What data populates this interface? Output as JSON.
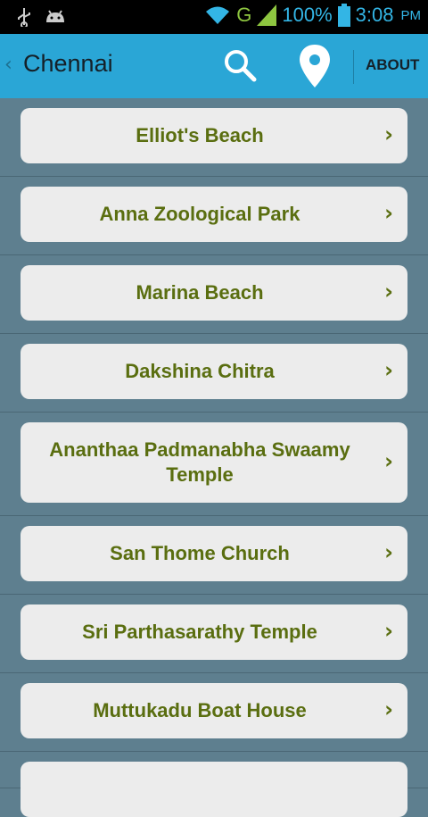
{
  "status_bar": {
    "battery": "100%",
    "network": "G",
    "time": "3:08",
    "ampm": "PM"
  },
  "app_bar": {
    "back_glyph": "‹",
    "title": "Chennai",
    "about_label": "ABOUT",
    "search_icon": "search-icon",
    "map_icon": "map-pin-icon",
    "accent": "#2aa6d6"
  },
  "places": [
    {
      "name": "Elliot's Beach"
    },
    {
      "name": "Anna Zoological Park"
    },
    {
      "name": "Marina Beach"
    },
    {
      "name": "Dakshina Chitra"
    },
    {
      "name": "Ananthaa Padmanabha Swaamy Temple"
    },
    {
      "name": "San Thome Church"
    },
    {
      "name": "Sri Parthasarathy Temple"
    },
    {
      "name": "Muttukadu Boat House"
    }
  ],
  "colors": {
    "background": "#5e7f8f",
    "card": "#ececec",
    "label": "#5a6e10"
  }
}
